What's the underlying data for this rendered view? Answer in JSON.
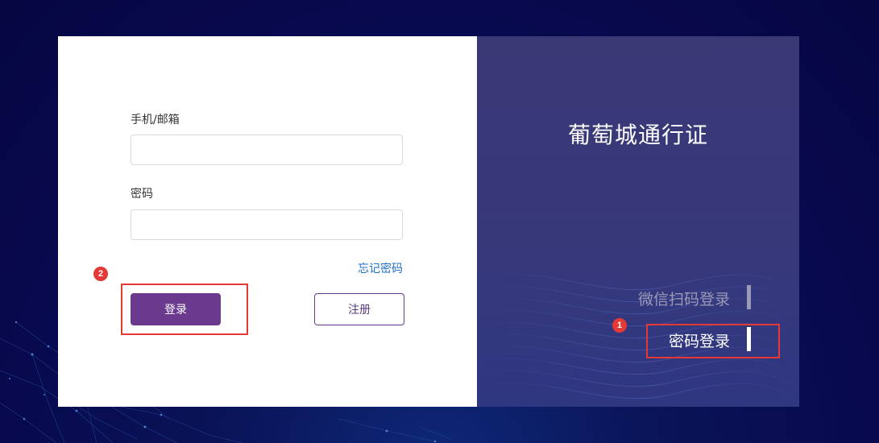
{
  "login_form": {
    "account_label": "手机/邮箱",
    "account_value": "",
    "password_label": "密码",
    "password_value": "",
    "forgot_password": "忘记密码",
    "login_button": "登录",
    "register_button": "注册"
  },
  "side_panel": {
    "title": "葡萄城通行证",
    "tabs": [
      {
        "label": "微信扫码登录",
        "active": false
      },
      {
        "label": "密码登录",
        "active": true
      }
    ]
  },
  "annotations": {
    "step_1": "1",
    "step_2": "2"
  },
  "colors": {
    "primary_button": "#6a3a8e",
    "link": "#1e6fc9",
    "side_panel_bg": "#3b3876",
    "highlight": "#e53935",
    "page_bg": "#08094e"
  }
}
